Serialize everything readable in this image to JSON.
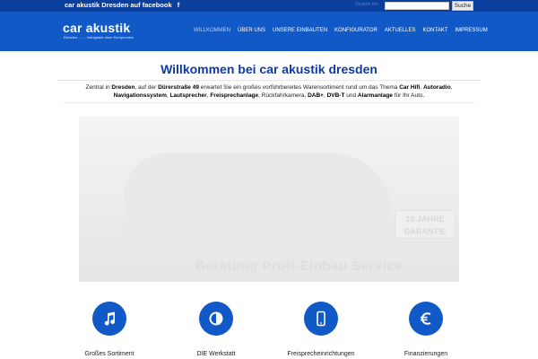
{
  "topbar": {
    "facebook_link": "car akustik Dresden auf facebook",
    "facebook_icon": "f",
    "search_label": "Search for:",
    "search_value": "",
    "search_button": "Suche"
  },
  "header": {
    "logo_text": "car akustik",
    "logo_tagline": "Dresden ........ klangstark ohne Kompromiss"
  },
  "nav": {
    "items": [
      "WILLKOMMEN",
      "ÜBER UNS",
      "UNSERE EINBAUTEN",
      "KONFIGURATOR",
      "AKTUELLES",
      "KONTAKT",
      "IMPRESSUM"
    ]
  },
  "main": {
    "title": "Willkommen bei  car akustik dresden",
    "intro": {
      "p1": "Zentral in ",
      "b1": "Dresden",
      "p2": ", auf der ",
      "b2": "Dürerstraße 49",
      "p3": " erwartet Sie ein großes vorführbereites Warensortiment rund um das Thema ",
      "b3": "Car Hifi",
      "p4": ", ",
      "b4": "Autoradio",
      "p5": ", ",
      "b5": "Navigationssystem",
      "p6": ", ",
      "b6": "Lautsprecher",
      "p7": ", ",
      "b7": "Freisprechanlage",
      "p8": ", Rückfahrkamera, ",
      "b8": "DAB+",
      "p9": ", ",
      "b9": "DVB-T",
      "p10": " und ",
      "b10": "Alarmanlage",
      "p11": " für Ihr Auto."
    },
    "hero": {
      "slogan": "Beratung   Profi-Einbau   Service",
      "badge": "10 JAHRE GARANTIE"
    }
  },
  "features": [
    {
      "label": "Großes Sortiment",
      "icon": "music-note-icon"
    },
    {
      "label": "DIE Werkstatt",
      "icon": "contrast-icon"
    },
    {
      "label": "Freisprecheinrichtungen",
      "icon": "mobile-phone-icon"
    },
    {
      "label": "Finanzierungen",
      "icon": "euro-icon"
    }
  ],
  "colors": {
    "topbar": "#0b3f9e",
    "header": "#1059c7",
    "title": "#0c3aa5",
    "feature_circle": "#1059c7"
  }
}
